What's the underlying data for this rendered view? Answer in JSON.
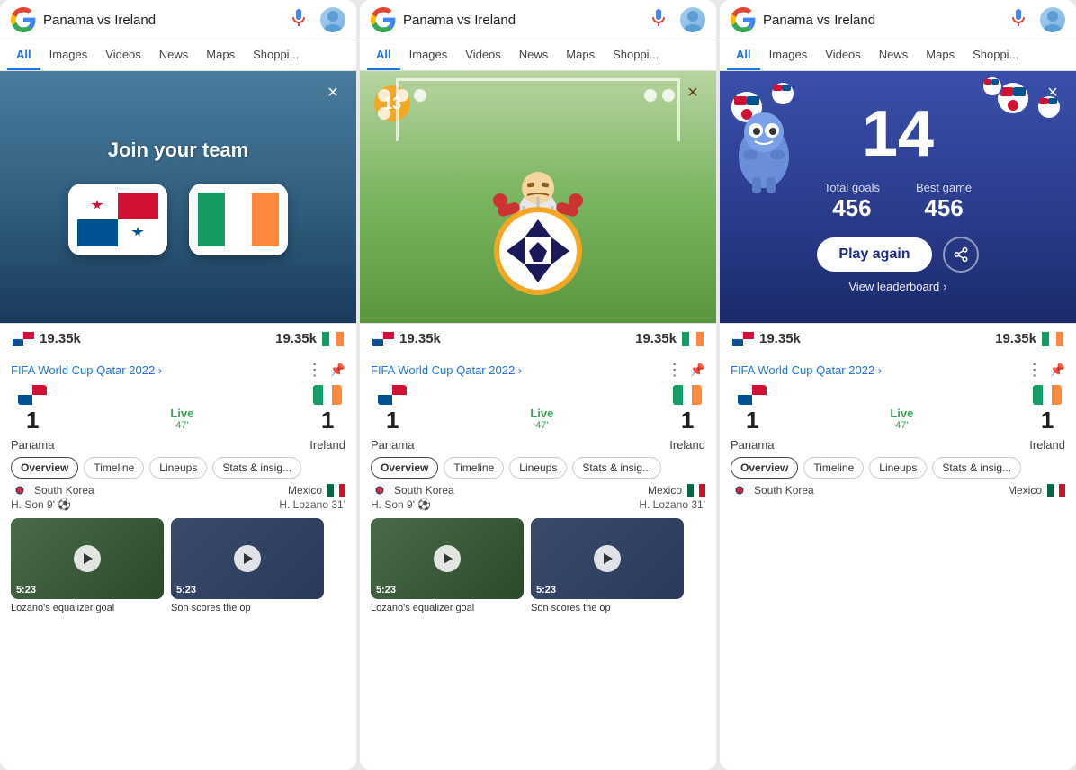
{
  "search": {
    "query": "Panama vs Ireland",
    "mic_label": "microphone",
    "avatar_label": "user avatar"
  },
  "nav": {
    "tabs": [
      "All",
      "Images",
      "Videos",
      "News",
      "Maps",
      "Shoppi..."
    ],
    "active": "All"
  },
  "panels": {
    "panel1": {
      "title": "Join your team",
      "team1": "Panama",
      "team2": "Ireland",
      "close": "×"
    },
    "panel2": {
      "score": "13",
      "score_left": "19.35k",
      "score_right": "19.35k",
      "close": "×"
    },
    "panel3": {
      "big_score": "14",
      "total_goals_label": "Total goals",
      "total_goals_val": "456",
      "best_game_label": "Best game",
      "best_game_val": "456",
      "play_again": "Play again",
      "view_leaderboard": "View leaderboard",
      "score_left": "19.35k",
      "score_right": "19.35k",
      "close": "×"
    }
  },
  "match": {
    "competition": "FIFA World Cup Qatar 2022 ›",
    "score_home": "1",
    "score_away": "1",
    "live": "Live",
    "minute": "47'",
    "team_home": "Panama",
    "team_away": "Ireland",
    "tabs": [
      "Overview",
      "Timeline",
      "Lineups",
      "Stats & insig..."
    ],
    "goals": [
      {
        "team": "South Korea",
        "player": "H. Son 9'"
      },
      {
        "team": "Mexico",
        "player": "H. Lozano 31'"
      }
    ],
    "videos": [
      {
        "duration": "5:23",
        "label": "Lozano's equalizer goal"
      },
      {
        "duration": "5:23",
        "label": "Son scores the op"
      }
    ]
  }
}
